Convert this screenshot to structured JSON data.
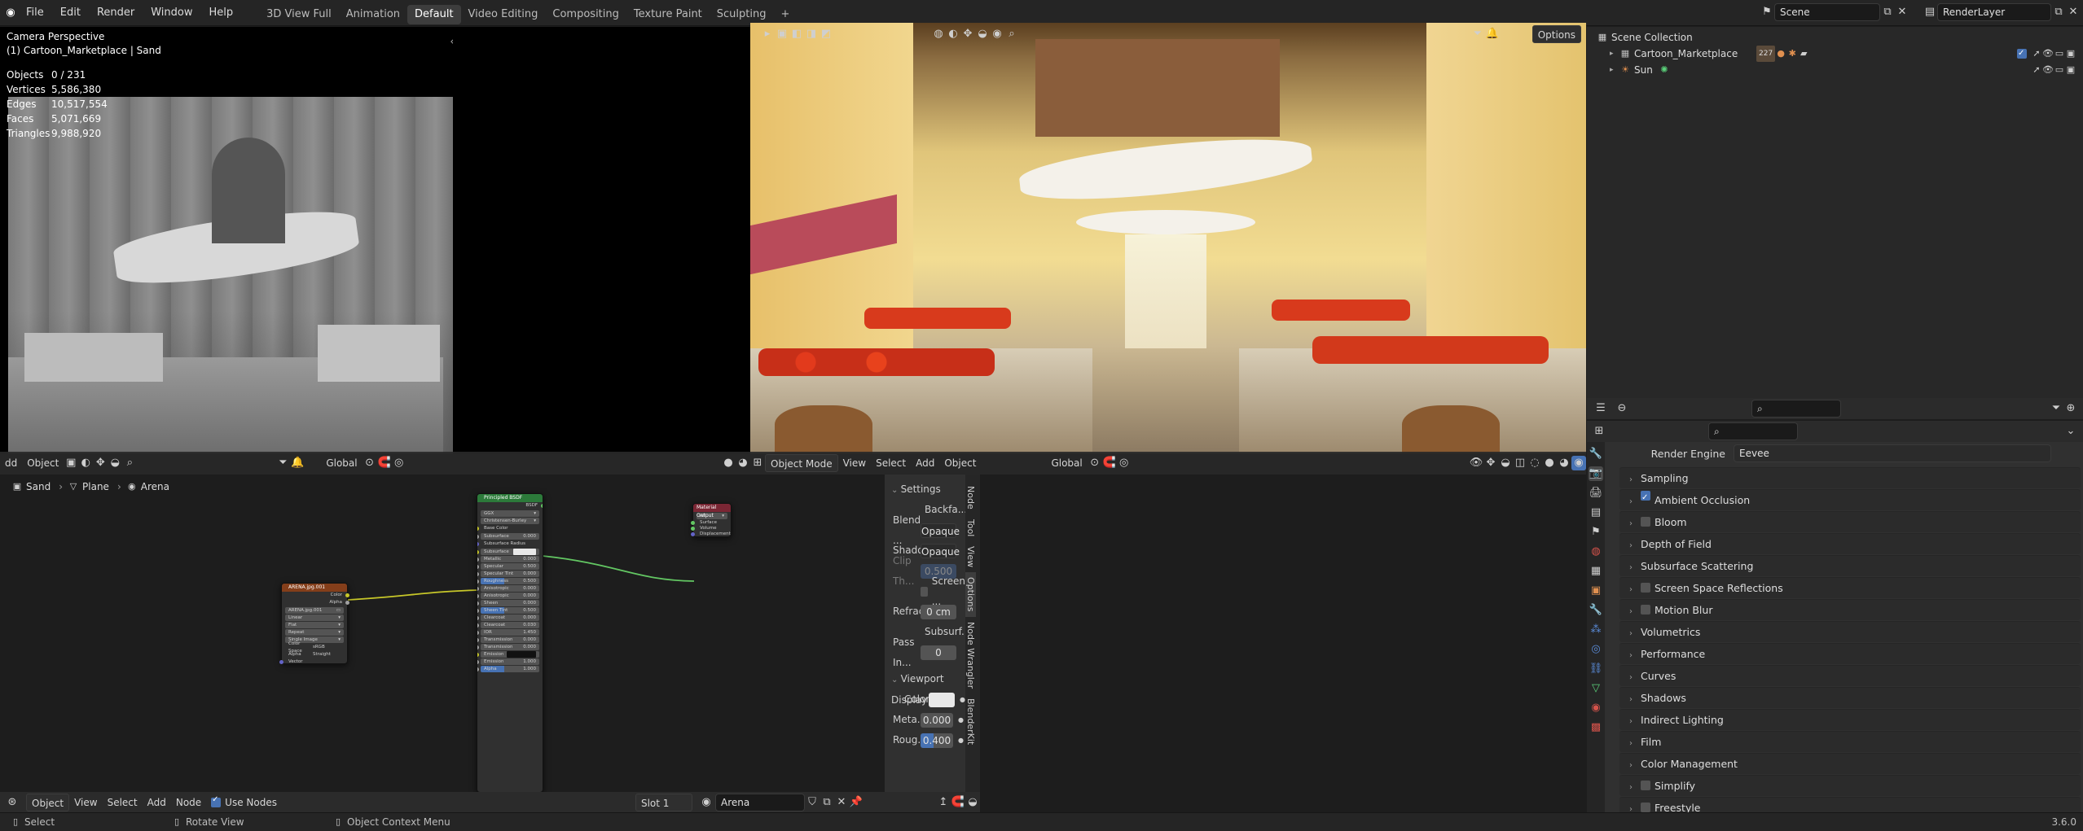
{
  "topbar": {
    "menu": [
      "File",
      "Edit",
      "Render",
      "Window",
      "Help"
    ],
    "workspaces": [
      "3D View Full",
      "Animation",
      "Default",
      "Video Editing",
      "Compositing",
      "Texture Paint",
      "Sculpting"
    ],
    "active_workspace": "Default",
    "add_tab": "+",
    "scene": "Scene",
    "view_layer": "RenderLayer"
  },
  "left_viewport": {
    "title": "Camera Perspective",
    "subtitle": "(1) Cartoon_Marketplace | Sand",
    "stats": [
      {
        "label": "Objects",
        "value": "0 / 231"
      },
      {
        "label": "Vertices",
        "value": "5,586,380"
      },
      {
        "label": "Edges",
        "value": "10,517,554"
      },
      {
        "label": "Faces",
        "value": "5,071,669"
      },
      {
        "label": "Triangles",
        "value": "9,988,920"
      }
    ],
    "header": {
      "add": "dd",
      "object": "Object",
      "orientation": "Global"
    }
  },
  "right_viewport": {
    "options": "Options",
    "header": {
      "mode": "Object Mode",
      "view": "View",
      "select": "Select",
      "add": "Add",
      "object": "Object",
      "orientation": "Global"
    }
  },
  "outliner": {
    "root": "Scene Collection",
    "items": [
      {
        "name": "Cartoon_Marketplace",
        "badge": "227"
      },
      {
        "name": "Sun"
      }
    ]
  },
  "properties": {
    "render_engine_label": "Render Engine",
    "render_engine": "Eevee",
    "sections": [
      {
        "label": "Sampling",
        "checkbox": false,
        "checked": false
      },
      {
        "label": "Ambient Occlusion",
        "checkbox": true,
        "checked": true
      },
      {
        "label": "Bloom",
        "checkbox": true,
        "checked": false
      },
      {
        "label": "Depth of Field",
        "checkbox": false,
        "checked": false
      },
      {
        "label": "Subsurface Scattering",
        "checkbox": false,
        "checked": false
      },
      {
        "label": "Screen Space Reflections",
        "checkbox": true,
        "checked": false
      },
      {
        "label": "Motion Blur",
        "checkbox": true,
        "checked": false
      },
      {
        "label": "Volumetrics",
        "checkbox": false,
        "checked": false
      },
      {
        "label": "Performance",
        "checkbox": false,
        "checked": false
      },
      {
        "label": "Curves",
        "checkbox": false,
        "checked": false
      },
      {
        "label": "Shadows",
        "checkbox": false,
        "checked": false
      },
      {
        "label": "Indirect Lighting",
        "checkbox": false,
        "checked": false
      },
      {
        "label": "Film",
        "checkbox": false,
        "checked": false
      },
      {
        "label": "Color Management",
        "checkbox": false,
        "checked": false
      },
      {
        "label": "Simplify",
        "checkbox": true,
        "checked": false
      },
      {
        "label": "Freestyle",
        "checkbox": true,
        "checked": false
      }
    ]
  },
  "node_editor": {
    "breadcrumb": [
      "Sand",
      "Plane",
      "Arena"
    ],
    "footer": {
      "object": "Object",
      "view": "View",
      "select": "Select",
      "add": "Add",
      "node": "Node",
      "use_nodes": "Use Nodes",
      "slot": "Slot 1",
      "material": "Arena"
    },
    "image_node": {
      "title": "ARENA.jpg.001",
      "out_color": "Color",
      "out_alpha": "Alpha",
      "image": "ARENA.jpg.001",
      "fields": [
        "Linear",
        "Flat",
        "Repeat",
        "Single Image"
      ],
      "colorspace_label": "Color Space",
      "colorspace": "sRGB",
      "alpha_label": "Alpha",
      "alpha": "Straight",
      "vector": "Vector"
    },
    "bsdf_node": {
      "title": "Principled BSDF",
      "out": "BSDF",
      "dist": "GGX",
      "sss_method": "Christensen-Burley",
      "rows": [
        {
          "label": "Base Color",
          "value": "",
          "kind": "plain"
        },
        {
          "label": "Subsurface",
          "value": "0.000",
          "kind": "field"
        },
        {
          "label": "Subsurface Radius",
          "value": "",
          "kind": "plain"
        },
        {
          "label": "Subsurface Color",
          "value": "",
          "kind": "color"
        },
        {
          "label": "Metallic",
          "value": "0.000",
          "kind": "field"
        },
        {
          "label": "Specular",
          "value": "0.500",
          "kind": "field"
        },
        {
          "label": "Specular Tint",
          "value": "0.000",
          "kind": "field"
        },
        {
          "label": "Roughness",
          "value": "0.500",
          "kind": "blue"
        },
        {
          "label": "Anisotropic",
          "value": "0.000",
          "kind": "field"
        },
        {
          "label": "Anisotropic Rotation",
          "value": "0.000",
          "kind": "field"
        },
        {
          "label": "Sheen",
          "value": "0.000",
          "kind": "field"
        },
        {
          "label": "Sheen Tint",
          "value": "0.500",
          "kind": "blue"
        },
        {
          "label": "Clearcoat",
          "value": "0.000",
          "kind": "field"
        },
        {
          "label": "Clearcoat Roughness",
          "value": "0.030",
          "kind": "field"
        },
        {
          "label": "IOR",
          "value": "1.450",
          "kind": "field"
        },
        {
          "label": "Transmission",
          "value": "0.000",
          "kind": "field"
        },
        {
          "label": "Transmission Roughness",
          "value": "0.000",
          "kind": "field"
        },
        {
          "label": "Emission",
          "value": "",
          "kind": "dark"
        },
        {
          "label": "Emission Strength",
          "value": "1.000",
          "kind": "field"
        },
        {
          "label": "Alpha",
          "value": "1.000",
          "kind": "blue"
        }
      ]
    },
    "output_node": {
      "title": "Material Output",
      "target": "All",
      "inputs": [
        "Surface",
        "Volume",
        "Displacement"
      ]
    }
  },
  "side_tabs": [
    "Node",
    "Tool",
    "View",
    "Options",
    "Node Wrangler",
    "BlenderKit"
  ],
  "n_panel": {
    "settings": "Settings",
    "backface": "Backfa...",
    "blend_label": "Blend ...",
    "blend": "Opaque",
    "shadow_label": "Shado...",
    "shadow": "Opaque",
    "clip_label": "Clip Th...",
    "clip": "0.500",
    "screen": "Screen ...",
    "refraction_label": "Refrac...",
    "refraction": "0 cm",
    "subsurf": "Subsurf...",
    "pass_label": "Pass In...",
    "pass": "0",
    "viewport_display": "Viewport Display",
    "color_label": "Color",
    "metallic_label": "Meta...",
    "metallic": "0.000",
    "roughness_label": "Roug...",
    "roughness": "0.400"
  },
  "statusbar": {
    "select": "Select",
    "rotate": "Rotate View",
    "context": "Object Context Menu",
    "version": "3.6.0"
  },
  "colors": {
    "accent": "#4772b3",
    "image_node_header": "#843e1a",
    "bsdf_node_header": "#2c7a3a",
    "output_node_header": "#7a2634"
  }
}
